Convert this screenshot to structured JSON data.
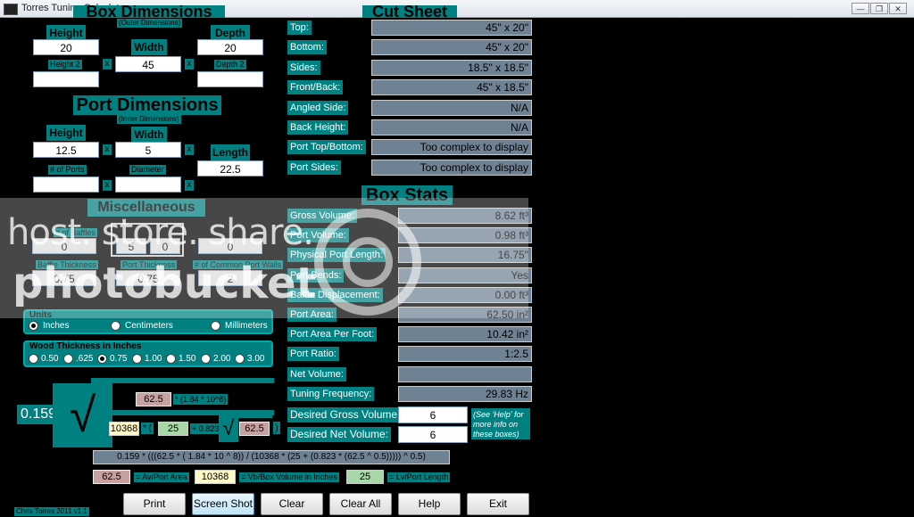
{
  "window": {
    "title": "Torres Tuning Calculator",
    "minimize": "—",
    "restore": "❐",
    "close": "✕"
  },
  "box": {
    "heading": "Box Dimensions",
    "subheading": "(Outer Dimensions)",
    "height_label": "Height",
    "height_value": "20",
    "width_label": "Width",
    "width_value": "45",
    "depth_label": "Depth",
    "depth_value": "20",
    "height2_label": "Height 2",
    "height2_value": "",
    "depth2_label": "Depth 2",
    "depth2_value": "",
    "x": "x"
  },
  "port": {
    "heading": "Port Dimensions",
    "subheading": "(Inner Dimensions)",
    "height_label": "Height",
    "height_value": "12.5",
    "width_label": "Width",
    "width_value": "5",
    "length_label": "Length",
    "length_value": "22.5",
    "ports_label": "# of Ports",
    "ports_value": "",
    "diameter_label": "Diameter",
    "diameter_value": ""
  },
  "misc": {
    "heading": "Miscellaneous",
    "baffles_label": "# of Baffles",
    "baffles_value": "0",
    "bends_value_a": "5",
    "bends_value_b": "0",
    "extra_value": "0",
    "baffle_thickness_label": "Baffle Thickness",
    "baffle_thickness_value": "0.75",
    "port_thickness_label": "Port Thickness",
    "port_thickness_value": "0.75",
    "common_walls_label": "# of Common Port Walls",
    "common_walls_value": "2"
  },
  "units": {
    "legend": "Units",
    "options": [
      "Inches",
      "Centimeters",
      "Millimeters"
    ],
    "selected": "Inches"
  },
  "wood": {
    "legend": "Wood Thickness in Inches",
    "options": [
      "0.50",
      ".625",
      "0.75",
      "1.00",
      "1.50",
      "2.00",
      "3.00"
    ],
    "selected": "0.75"
  },
  "formula": {
    "coef": "0.159",
    "av": "62.5",
    "const_text": "* (1.84 * 10^8)",
    "vb": "10368",
    "open": "* (",
    "lv": "25",
    "plus_text": "+ 0.823",
    "av2": "62.5",
    "close": ")",
    "full": "0.159 * (((62.5 * ( 1.84 * 10 ^ 8)) / (10368 * (25 + (0.823 * (62.5 ^ 0.5))))) ^ 0.5)",
    "legend_av": "62.5",
    "legend_av_label": "= Av/Port Area",
    "legend_vb": "10368",
    "legend_vb_label": "= Vb/Box Volume in Inches",
    "legend_lv": "25",
    "legend_lv_label": "= Lv/Port Length"
  },
  "cutsheet": {
    "heading": "Cut Sheet",
    "rows": [
      {
        "label": "Top:",
        "value": "45\" x 20\""
      },
      {
        "label": "Bottom:",
        "value": "45\" x 20\""
      },
      {
        "label": "Sides:",
        "value": "18.5\" x 18.5\""
      },
      {
        "label": "Front/Back:",
        "value": "45\" x 18.5\""
      },
      {
        "label": "Angled Side:",
        "value": "N/A"
      },
      {
        "label": "Back Height:",
        "value": "N/A"
      },
      {
        "label": "Port Top/Bottom:",
        "value": "Too complex to display"
      },
      {
        "label": "Port Sides:",
        "value": "Too complex to display"
      }
    ]
  },
  "stats": {
    "heading": "Box Stats",
    "rows": [
      {
        "label": "Gross Volume:",
        "value": "8.62 ft³"
      },
      {
        "label": "Port Volume:",
        "value": "0.98 ft³"
      },
      {
        "label": "Physical Port Length:",
        "value": "16.75\""
      },
      {
        "label": "Port Bends:",
        "value": "Yes"
      },
      {
        "label": "Baffle Displacement:",
        "value": "0.00 ft³"
      },
      {
        "label": "Port Area:",
        "value": "62.50 in²"
      },
      {
        "label": "Port Area Per Foot:",
        "value": "10.42 in²"
      },
      {
        "label": "Port Ratio:",
        "value": "1:2.5"
      },
      {
        "label": "Net Volume:",
        "value": ""
      },
      {
        "label": "Tuning Frequency:",
        "value": "29.83 Hz"
      }
    ],
    "desired_gross_label": "Desired Gross Volume:",
    "desired_gross_value": "6",
    "desired_net_label": "Desired Net Volume:",
    "desired_net_value": "6",
    "help_note": "(See 'Help' for more info on these boxes)"
  },
  "buttons": [
    "Print",
    "Screen Shot",
    "Clear",
    "Clear All",
    "Help",
    "Exit"
  ],
  "footer": "Chris Torres 2011 v1.1",
  "watermark": {
    "line1": "host. store. share.",
    "line2": "photobucket"
  }
}
